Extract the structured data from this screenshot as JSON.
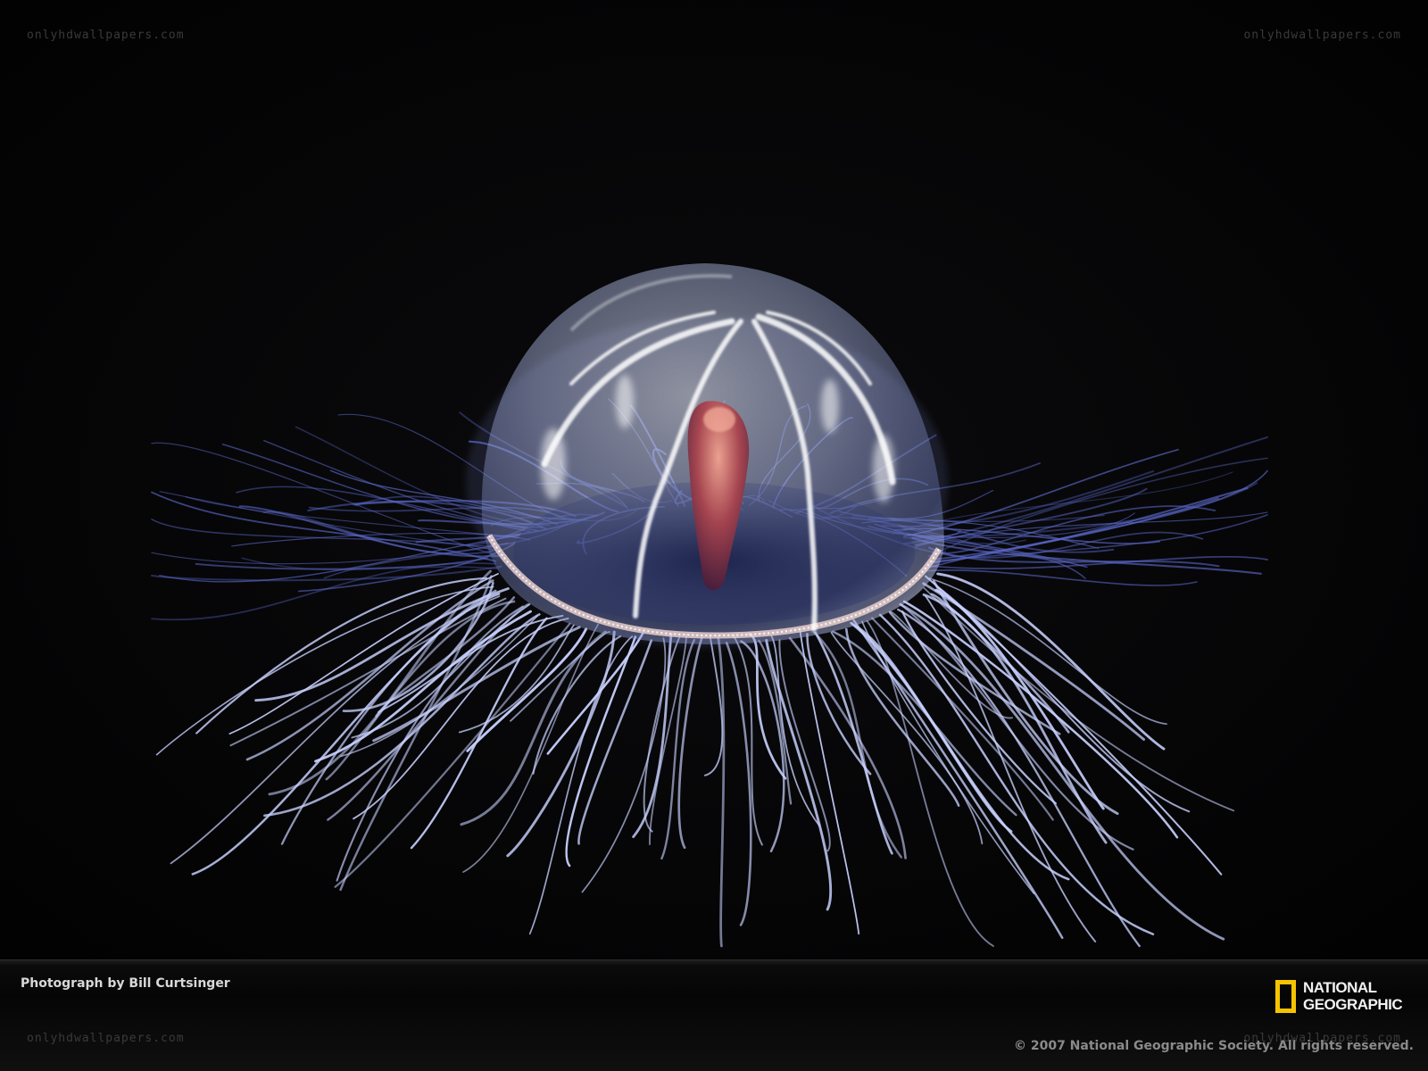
{
  "watermarks": {
    "top_left": "onlyhdwallpapers.com",
    "top_right": "onlyhdwallpapers.com",
    "bottom_left": "onlyhdwallpapers.com",
    "bottom_right": "onlyhdwallpapers.com"
  },
  "caption": {
    "credit": "Photograph by Bill Curtsinger",
    "copyright": "© 2007 National Geographic Society. All rights reserved."
  },
  "logo": {
    "line1": "NATIONAL",
    "line2": "GEOGRAPHIC",
    "frame_color": "#f5c400"
  },
  "colors": {
    "background": "#040404",
    "tentacle": "#c9d2ff",
    "bell": "#dfe6ff",
    "gut": "#b04a4e"
  }
}
